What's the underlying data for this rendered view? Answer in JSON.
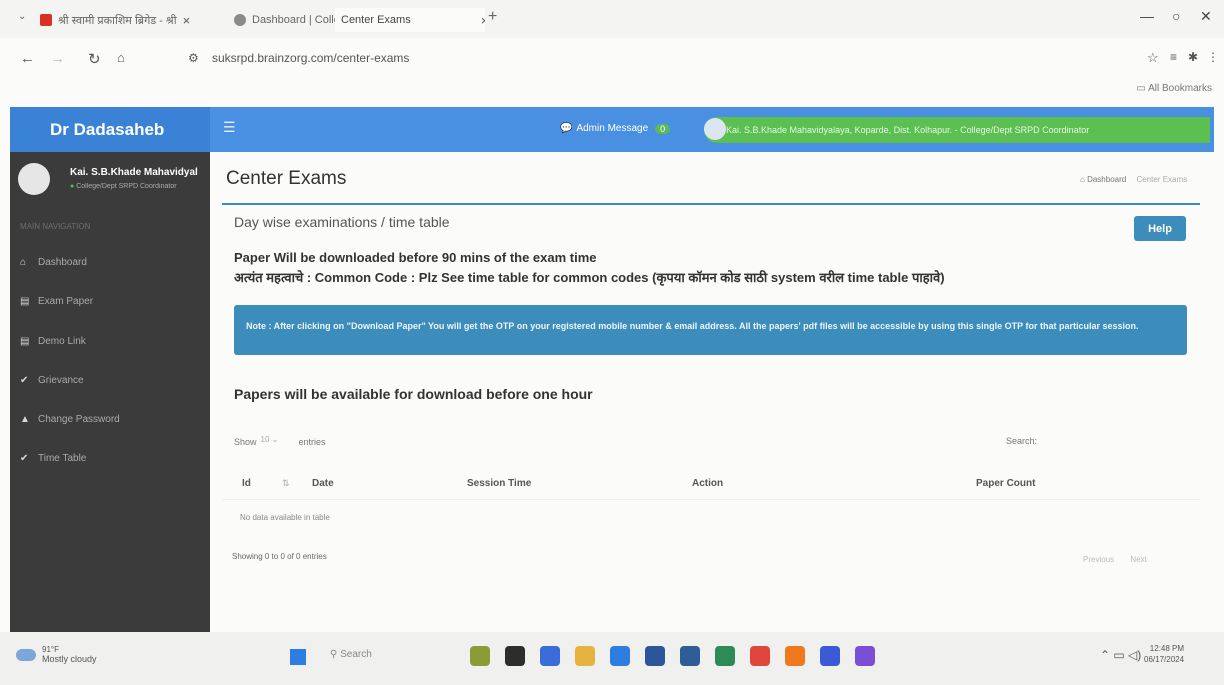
{
  "browser": {
    "tabs": [
      {
        "label": "श्री स्वामी प्रकाशिम ब्रिगेड - श्री",
        "icon": "youtube-icon",
        "color": "#d93025"
      },
      {
        "label": "Dashboard | College Manage",
        "icon": "globe-icon",
        "color": "#8a8a8a"
      },
      {
        "label": "Center Exams",
        "icon": "site-icon",
        "color": "#8a8a8a"
      }
    ],
    "url": "suksrpd.brainzorg.com/center-exams",
    "bookmarks_label": "All Bookmarks"
  },
  "header": {
    "brand": "Dr Dadasaheb",
    "admin_message_label": "Admin Message",
    "admin_message_count": "0",
    "user_line": "Kai. S.B.Khade Mahavidyalaya, Koparde, Dist. Kolhapur. - College/Dept SRPD Coordinator"
  },
  "sidebar": {
    "user_name": "Kai. S.B.Khade Mahavidyal",
    "user_role": "College/Dept SRPD Coordinator",
    "section_heading": "MAIN NAVIGATION",
    "items": [
      {
        "label": "Dashboard",
        "icon": "dashboard-icon",
        "glyph": "⌂"
      },
      {
        "label": "Exam Paper",
        "icon": "file-icon",
        "glyph": "▤"
      },
      {
        "label": "Demo Link",
        "icon": "file-icon",
        "glyph": "▤"
      },
      {
        "label": "Grievance",
        "icon": "check-icon",
        "glyph": "✔"
      },
      {
        "label": "Change Password",
        "icon": "lock-icon",
        "glyph": "🔒"
      },
      {
        "label": "Time Table",
        "icon": "check-icon",
        "glyph": "✔"
      }
    ]
  },
  "main": {
    "title": "Center Exams",
    "breadcrumb_home": "Dashboard",
    "breadcrumb_current": "Center Exams",
    "box_title": "Day wise examinations / time table",
    "help_label": "Help",
    "notice_line1": "Paper Will be downloaded before 90 mins of the exam time",
    "notice_line2": "अत्यंत महत्वाचे : Common Code : Plz See time table for common codes (कृपया कॉमन कोड साठी system वरील time table पाहावे)",
    "callout": "Note : After clicking on \"Download Paper\" You will get the OTP on your registered mobile number & email address. All the papers' pdf files will be accessible by using this single OTP for that particular session.",
    "availability": "Papers will be available for download before one hour",
    "table": {
      "show_label": "Show",
      "entries_value": "10",
      "entries_label": "entries",
      "search_label": "Search:",
      "columns": [
        "Id",
        "Date",
        "Session Time",
        "Action",
        "Paper Count"
      ],
      "empty_message": "No data available in table",
      "info": "Showing 0 to 0 of 0 entries",
      "prev": "Previous",
      "next": "Next"
    }
  },
  "taskbar": {
    "weather_temp": "91°F",
    "weather_text": "Mostly cloudy",
    "search_label": "Search",
    "time": "12:48 PM",
    "date": "06/17/2024",
    "app_colors": [
      "#8a9b3a",
      "#2d2d2d",
      "#3b6bd6",
      "#e6b341",
      "#2f7de1",
      "#2b579a",
      "#2f5d9a",
      "#2e8b57",
      "#e0453a",
      "#f07a1b",
      "#3b5bd6",
      "#7a4fd6"
    ]
  }
}
